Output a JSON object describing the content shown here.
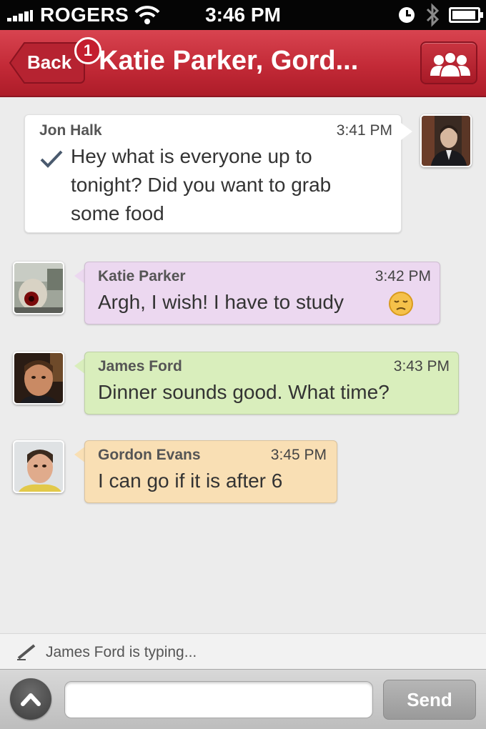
{
  "status_bar": {
    "carrier": "ROGERS",
    "time": "3:46 PM"
  },
  "nav": {
    "back_label": "Back",
    "badge_count": "1",
    "title": "Katie Parker, Gord..."
  },
  "messages": [
    {
      "sender": "Jon Halk",
      "time": "3:41 PM",
      "lines": [
        "Hey what is everyone up to",
        "tonight? Did you want to grab",
        "some food"
      ],
      "delivered": true,
      "bubble_color": "#ffffff"
    },
    {
      "sender": "Katie Parker",
      "time": "3:42 PM",
      "text": "Argh, I wish! I have to study",
      "emoji": "sad-face",
      "bubble_color": "#ecd8f0"
    },
    {
      "sender": "James Ford",
      "time": "3:43 PM",
      "text": "Dinner sounds good. What time?",
      "bubble_color": "#d9eebc"
    },
    {
      "sender": "Gordon Evans",
      "time": "3:45 PM",
      "text": "I can go if it is after 6",
      "bubble_color": "#f9dfb4"
    }
  ],
  "typing": {
    "text": "James Ford is typing..."
  },
  "compose": {
    "input_value": "",
    "send_label": "Send"
  },
  "colors": {
    "nav_red": "#c32a37",
    "background": "#ececec"
  },
  "icons": [
    "signal-icon",
    "wifi-icon",
    "clock-icon",
    "bluetooth-icon",
    "battery-icon",
    "group-icon",
    "check-icon",
    "pencil-icon",
    "chevron-up-icon"
  ]
}
